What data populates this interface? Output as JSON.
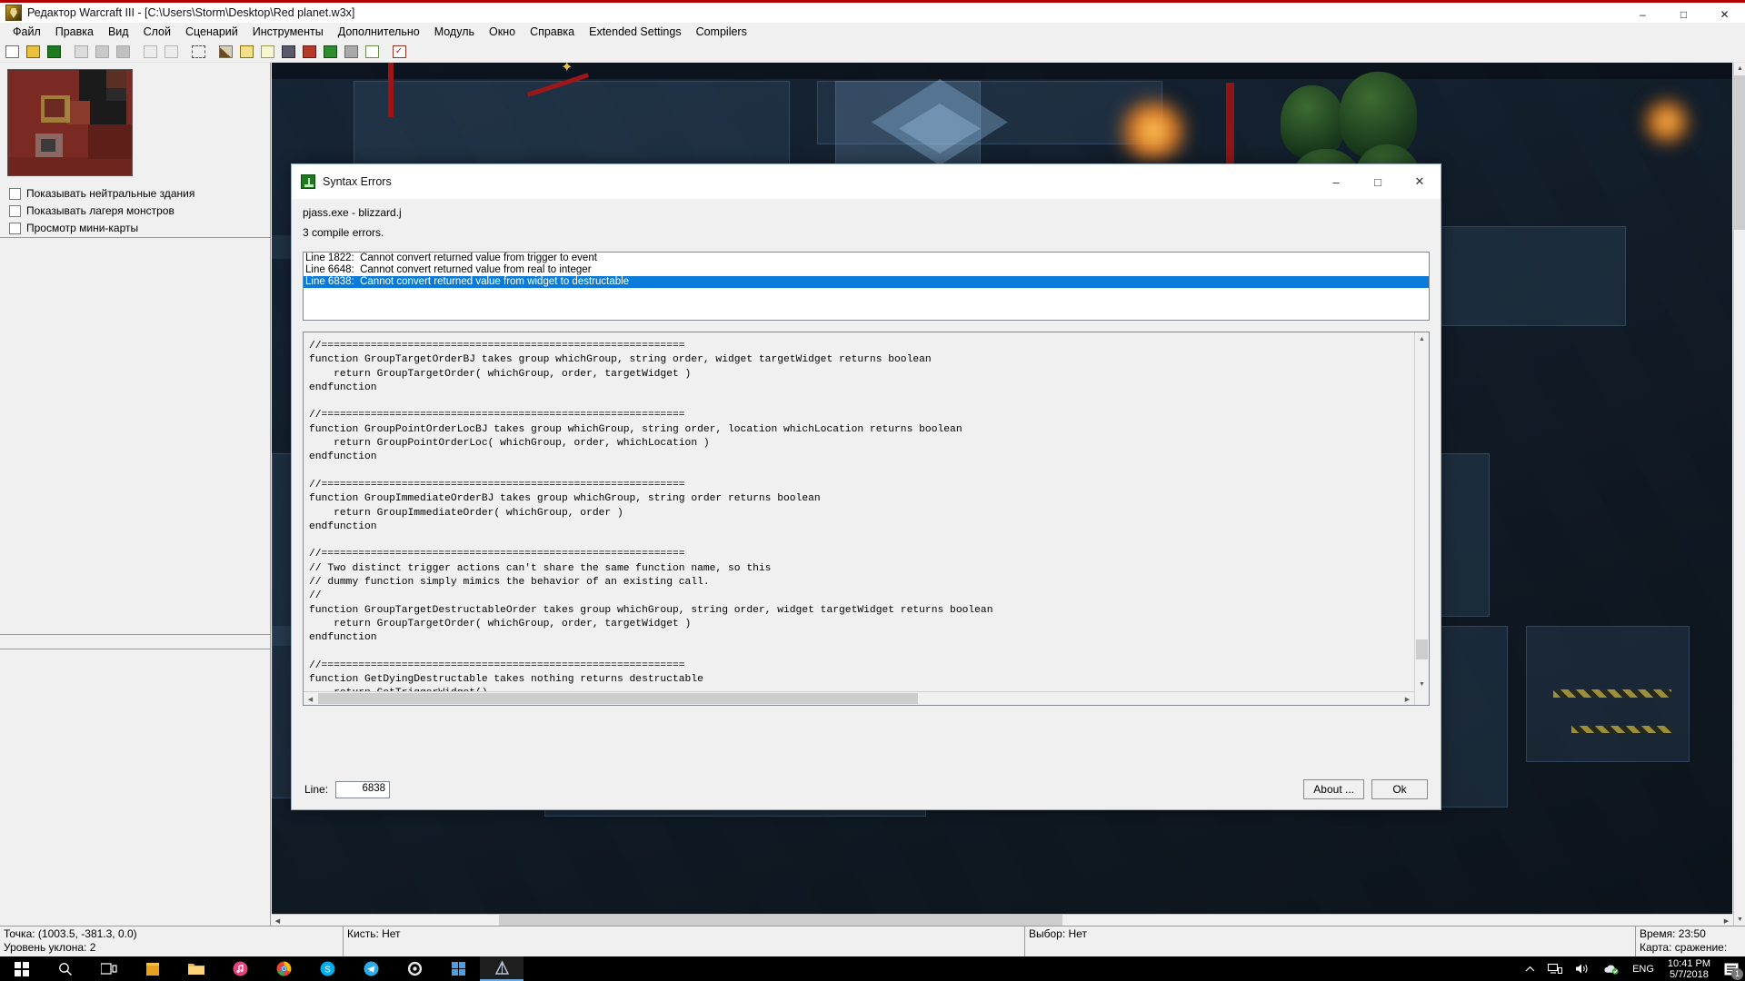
{
  "window": {
    "title": "Редактор Warcraft III  - [C:\\Users\\Storm\\Desktop\\Red planet.w3x]",
    "icon": "warcraft-editor-icon",
    "minimize": "–",
    "maximize": "□",
    "close": "✕"
  },
  "menubar": {
    "items": [
      "Файл",
      "Правка",
      "Вид",
      "Слой",
      "Сценарий",
      "Инструменты",
      "Дополнительно",
      "Модуль",
      "Окно",
      "Справка",
      "Extended Settings",
      "Compilers"
    ]
  },
  "toolbar": {
    "buttons": [
      "new-file-icon",
      "open-folder-icon",
      "save-disk-icon",
      "cut-scissors-icon",
      "copy-icon",
      "paste-icon",
      "undo-icon",
      "redo-icon",
      "select-marquee-icon",
      "terrain-icon",
      "doodad-icon",
      "sound-icon",
      "unit-icon",
      "region-icon",
      "camera-icon",
      "trigger-icon",
      "import-manager-icon",
      "object-editor-icon"
    ]
  },
  "left_panel": {
    "minimap": "minimap-preview",
    "checkboxes": [
      {
        "label": "Показывать нейтральные здания",
        "checked": false
      },
      {
        "label": "Показывать лагеря монстров",
        "checked": false
      },
      {
        "label": "Просмотр мини-карты",
        "checked": false
      }
    ]
  },
  "status_bar": {
    "point": "Точка: (1003.5, -381.3, 0.0)",
    "slope": "Уровень уклона: 2",
    "brush": "Кисть: Нет",
    "selection": "Выбор: Нет",
    "time": "Время: 23:50",
    "map_battle": "Карта: сражение: Нет"
  },
  "taskbar": {
    "start": "start-windows-icon",
    "apps": [
      "search-icon",
      "task-view-icon",
      "store-icon",
      "file-explorer-icon",
      "itunes-icon",
      "chrome-icon",
      "skype-icon",
      "telegram-icon",
      "settings-gear-icon",
      "office-icon",
      "warcraft-editor-icon"
    ],
    "tray": {
      "chevron": "show-hidden-icons-chevron",
      "network": "network-icon",
      "volume": "volume-icon",
      "cloud": "onedrive-sync-icon",
      "language": "ENG",
      "time": "10:41 PM",
      "date": "5/7/2018",
      "notifications": "notification-center-icon",
      "notification_count": "1"
    }
  },
  "dialog": {
    "title": "Syntax Errors",
    "icon": "pjass-icon",
    "minimize": "–",
    "maximize": "□",
    "close": "✕",
    "compiler_line": "pjass.exe - blizzard.j",
    "summary": "3 compile errors.",
    "errors": [
      {
        "text": "Line 1822:  Cannot convert returned value from trigger to event",
        "selected": false
      },
      {
        "text": "Line 6648:  Cannot convert returned value from real to integer",
        "selected": false
      },
      {
        "text": "Line 6838:  Cannot convert returned value from widget to destructable",
        "selected": true
      }
    ],
    "code_before": "//===========================================================\nfunction GroupTargetOrderBJ takes group whichGroup, string order, widget targetWidget returns boolean\n    return GroupTargetOrder( whichGroup, order, targetWidget )\nendfunction\n\n//===========================================================\nfunction GroupPointOrderLocBJ takes group whichGroup, string order, location whichLocation returns boolean\n    return GroupPointOrderLoc( whichGroup, order, whichLocation )\nendfunction\n\n//===========================================================\nfunction GroupImmediateOrderBJ takes group whichGroup, string order returns boolean\n    return GroupImmediateOrder( whichGroup, order )\nendfunction\n\n//===========================================================\n// Two distinct trigger actions can't share the same function name, so this\n// dummy function simply mimics the behavior of an existing call.\n//\nfunction GroupTargetDestructableOrder takes group whichGroup, string order, widget targetWidget returns boolean\n    return GroupTargetOrder( whichGroup, order, targetWidget )\nendfunction\n\n//===========================================================\nfunction GetDyingDestructable takes nothing returns destructable\n    return GetTriggerWidget()\n",
    "code_selected": "endfunction",
    "code_after": "\n//===========================================================",
    "line_label": "Line:",
    "line_value": "6838",
    "about_button": "About ...",
    "ok_button": "Ok"
  },
  "colors": {
    "selection_blue": "#0a7bd8",
    "title_red": "#b00000",
    "window_bg": "#f0f0f0"
  }
}
